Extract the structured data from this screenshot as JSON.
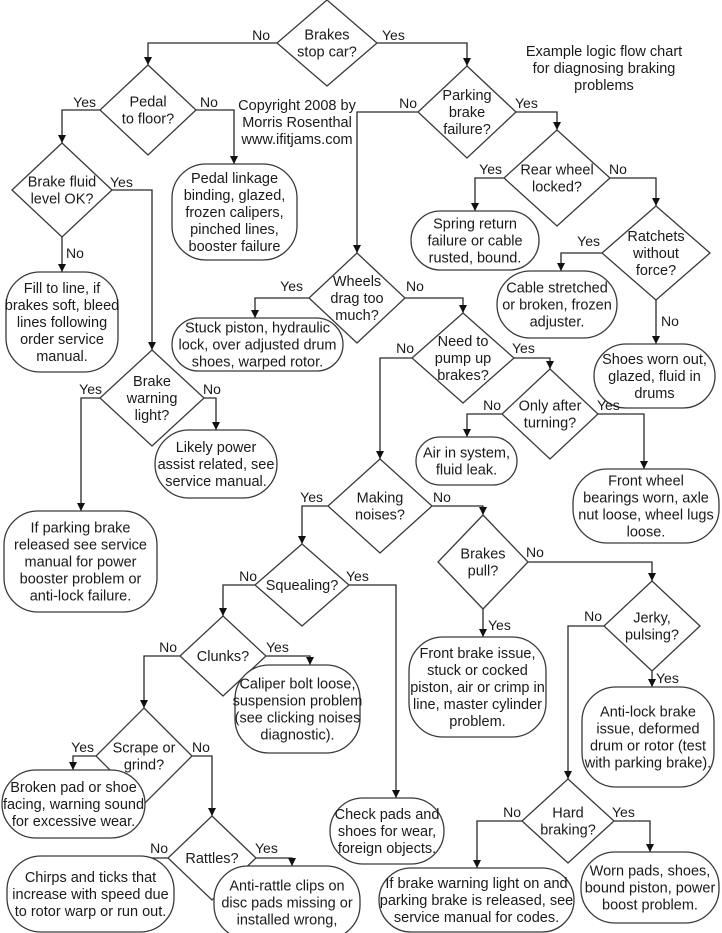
{
  "title": [
    "Example logic flow chart",
    "for diagnosing braking",
    "problems"
  ],
  "copyright": [
    "Copyright 2008 by",
    "Morris Rosenthal",
    "www.ifitjams.com"
  ],
  "decisions": {
    "brakes_stop": [
      "Brakes",
      "stop car?"
    ],
    "pedal_floor": [
      "Pedal",
      "to floor?"
    ],
    "fluid_ok": [
      "Brake fluid",
      "level OK?"
    ],
    "warning_light": [
      "Brake",
      "warning",
      "light?"
    ],
    "parking_failure": [
      "Parking",
      "brake",
      "failure?"
    ],
    "rear_locked": [
      "Rear wheel",
      "locked?"
    ],
    "ratchets": [
      "Ratchets",
      "without",
      "force?"
    ],
    "wheels_drag": [
      "Wheels",
      "drag too",
      "much?"
    ],
    "pump_up": [
      "Need to",
      "pump up",
      "brakes?"
    ],
    "after_turning": [
      "Only after",
      "turning?"
    ],
    "noises": [
      "Making",
      "noises?"
    ],
    "squealing": [
      "Squealing?"
    ],
    "clunks": [
      "Clunks?"
    ],
    "scrape": [
      "Scrape or",
      "grind?"
    ],
    "rattles": [
      "Rattles?"
    ],
    "pull": [
      "Brakes",
      "pull?"
    ],
    "jerky": [
      "Jerky,",
      "pulsing?"
    ],
    "hard": [
      "Hard",
      "braking?"
    ]
  },
  "outcomes": {
    "linkage": [
      "Pedal linkage",
      "binding, glazed,",
      "frozen calipers,",
      "pinched lines,",
      "booster failure"
    ],
    "fill": [
      "Fill to line, if",
      "brakes soft, bleed",
      "lines following",
      "order service",
      "manual."
    ],
    "power_assist": [
      "Likely power",
      "assist related, see",
      "service manual."
    ],
    "booster": [
      "If parking brake",
      "released see service",
      "manual for power",
      "booster problem or",
      "anti-lock failure."
    ],
    "spring": [
      "Spring return",
      "failure or cable",
      "rusted, bound."
    ],
    "cable": [
      "Cable stretched",
      "or broken, frozen",
      "adjuster."
    ],
    "shoes_worn": [
      "Shoes worn out,",
      "glazed, fluid in",
      "drums"
    ],
    "stuck_piston": [
      "Stuck piston, hydraulic",
      "lock, over adjusted drum",
      "shoes, warped rotor."
    ],
    "air": [
      "Air in system,",
      "fluid leak."
    ],
    "bearings": [
      "Front wheel",
      "bearings worn, axle",
      "nut loose, wheel lugs",
      "loose."
    ],
    "caliper": [
      "Caliper bolt loose,",
      "suspension problem",
      "(see clicking noises",
      "diagnostic)."
    ],
    "broken_pad": [
      "Broken pad or shoe",
      "facing, warning sound",
      "for excessive wear."
    ],
    "check_pads": [
      "Check pads and",
      "shoes for wear,",
      "foreign objects."
    ],
    "chirps": [
      "Chirps and ticks that",
      "increase with speed due",
      "to rotor warp or run out."
    ],
    "anti_rattle": [
      "Anti-rattle clips on",
      "disc pads missing or",
      "installed wrong,"
    ],
    "front_brake": [
      "Front brake issue,",
      "stuck or cocked",
      "piston, air or crimp in",
      "line, master cylinder",
      "problem."
    ],
    "antilock": [
      "Anti-lock brake",
      "issue, deformed",
      "drum or rotor (test",
      "with parking brake)."
    ],
    "warning_on": [
      "If brake warning light on and",
      "parking brake is released, see",
      "service manual for codes."
    ],
    "worn_pads": [
      "Worn pads, shoes,",
      "bound piston, power",
      "boost problem."
    ]
  },
  "labels": {
    "yes": "Yes",
    "no": "No"
  }
}
